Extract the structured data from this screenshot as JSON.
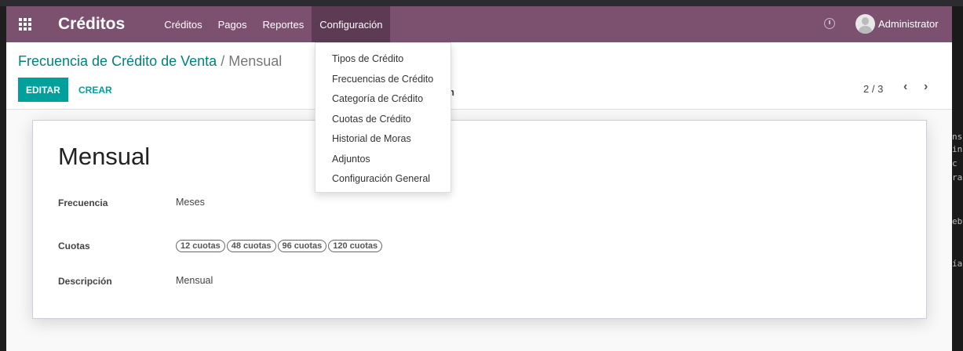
{
  "navbar": {
    "brand": "Créditos",
    "menu": [
      "Créditos",
      "Pagos",
      "Reportes",
      "Configuración"
    ],
    "active": "Configuración",
    "user": "Administrator",
    "color": "#7c5170"
  },
  "breadcrumb": {
    "parent": "Frecuencia de Crédito de Venta",
    "separator": "/",
    "current": "Mensual"
  },
  "buttons": {
    "edit": "EDITAR",
    "create": "CREAR"
  },
  "hidden_fragment": "n",
  "pager": {
    "value": "2 / 3",
    "prev": "‹",
    "next": "›"
  },
  "dropdown": [
    "Tipos de Crédito",
    "Frecuencias de Crédito",
    "Categoría de Crédito",
    "Cuotas de Crédito",
    "Historial de Moras",
    "Adjuntos",
    "Configuración General"
  ],
  "record": {
    "title": "Mensual",
    "fields": {
      "frecuencia_label": "Frecuencia",
      "frecuencia": "Meses",
      "cuotas_label": "Cuotas",
      "cuotas": [
        "12 cuotas",
        "48 cuotas",
        "96 cuotas",
        "120 cuotas"
      ],
      "descripcion_label": "Descripción",
      "descripcion": "Mensual"
    }
  },
  "terminal_fragments": [
    "ns",
    "in",
    " c",
    "ra",
    "eb",
    "ía"
  ]
}
